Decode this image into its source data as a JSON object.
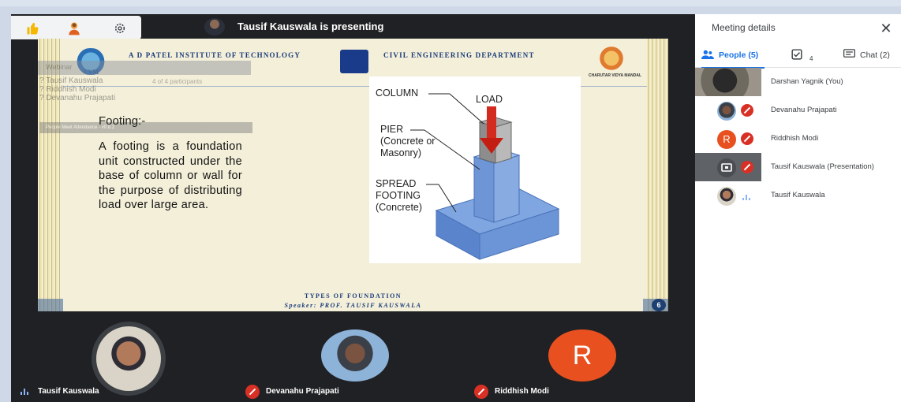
{
  "presenting": {
    "text": "Tausif Kauswala is presenting",
    "reactions": [
      "thumbs-up-icon",
      "raise-hand-icon",
      "gear-icon"
    ]
  },
  "slide": {
    "header_left": "A D PATEL INSTITUTE OF TECHNOLOGY",
    "header_right": "CIVIL ENGINEERING DEPARTMENT",
    "logo_left": "CVM",
    "logo_mid": "ADIT",
    "logo_right": "CHARUTAR VIDYA MANDAL",
    "title": "Footing:-",
    "body": "A footing is a foundation unit constructed under the base of column or wall for the purpose of distributing load over large area.",
    "diagram": {
      "column": "COLUMN",
      "load": "LOAD",
      "pier": "PIER\n(Concrete or\nMasonry)",
      "spread": "SPREAD\nFOOTING\n(Concrete)"
    },
    "footer_line1": "TYPES OF FOUNDATION",
    "footer_line2": "Speaker: PROF. TAUSIF KAUSWALA",
    "page_number": "6"
  },
  "ghost_overlay": {
    "title": "Webinar",
    "count": "4 of 4 participants",
    "names": [
      "? Tausif Kauswala",
      "? Riddhish Modi",
      "? Devanahu Prajapati"
    ],
    "footer": "People Meet Attendance - v0.8.2"
  },
  "tiles": [
    {
      "name": "Tausif Kauswala",
      "status": "speaking"
    },
    {
      "name": "Devanahu Prajapati",
      "status": "muted"
    },
    {
      "name": "Riddhish Modi",
      "status": "muted",
      "initial": "R"
    }
  ],
  "panel": {
    "title": "Meeting details",
    "tabs": {
      "people": "People (5)",
      "tasks_count": "4",
      "chat": "Chat (2)"
    },
    "participants": [
      {
        "name": "Darshan Yagnik (You)"
      },
      {
        "name": "Devanahu Prajapati"
      },
      {
        "name": "Riddhish Modi",
        "initial": "R"
      },
      {
        "name": "Tausif Kauswala (Presentation)"
      },
      {
        "name": "Tausif Kauswala"
      }
    ]
  },
  "colors": {
    "accent": "#1a73e8",
    "mute_red": "#d93025",
    "avatar_orange": "#e8501f",
    "stage_bg": "#202124"
  }
}
